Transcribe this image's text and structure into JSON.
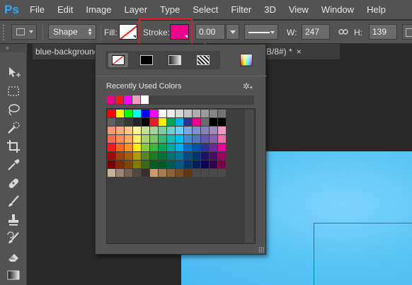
{
  "menubar": {
    "logo": "Ps",
    "items": [
      "File",
      "Edit",
      "Image",
      "Layer",
      "Type",
      "Select",
      "Filter",
      "3D",
      "View",
      "Window",
      "Help"
    ]
  },
  "options": {
    "mode": "Shape",
    "fill_label": "Fill:",
    "stroke_label": "Stroke:",
    "stroke_color": "#ec008c",
    "stroke_width": "0.00 pt",
    "w_label": "W:",
    "w_value": "247 px",
    "h_label": "H:",
    "h_value": "139 px"
  },
  "tabs": {
    "doc1": "blue-background",
    "doc2": "B/8#) *",
    "close": "×"
  },
  "swatch_panel": {
    "recent_label": "Recently Used Colors",
    "recent_colors": [
      "#ec008c",
      "#ed1c24",
      "#ff00ff",
      "#f49ac1",
      "#ffffff"
    ],
    "grid": [
      [
        "#ff0000",
        "#ffff00",
        "#00ff00",
        "#00ffff",
        "#0000ff",
        "#ff00ff",
        "#ffffff",
        "#ebebeb",
        "#d7d7d7",
        "#c3c3c3",
        "#afafaf",
        "#9b9b9b",
        "#878787",
        "#737373"
      ],
      [
        "#5f5f5f",
        "#4b4b4b",
        "#373737",
        "#232323",
        "#000000",
        "#ed1c24",
        "#fff200",
        "#00a651",
        "#00aeef",
        "#2e3192",
        "#ec008c",
        "#6b6b6b",
        "#000000",
        "#000000"
      ],
      [
        "#f7977a",
        "#f9ad81",
        "#fdc68a",
        "#fff79a",
        "#c4df9b",
        "#a3d39c",
        "#82ca9d",
        "#7accc8",
        "#6dcff6",
        "#7da7d9",
        "#8393ca",
        "#8781bd",
        "#a187be",
        "#f49ac1"
      ],
      [
        "#f26c4f",
        "#f68e55",
        "#fbaf5c",
        "#fff467",
        "#acd372",
        "#7cc576",
        "#3bb878",
        "#1abbb4",
        "#00bff3",
        "#438ccb",
        "#5574b9",
        "#605ca8",
        "#855fa8",
        "#f06ea9"
      ],
      [
        "#ed1c24",
        "#f26522",
        "#f7941d",
        "#fff200",
        "#8dc73f",
        "#39b54a",
        "#00a651",
        "#00a99d",
        "#00aeef",
        "#0072bc",
        "#0054a5",
        "#2e3192",
        "#662d91",
        "#ec008c"
      ],
      [
        "#9e0b0f",
        "#a0410d",
        "#a36209",
        "#aba000",
        "#598527",
        "#1a7b30",
        "#007236",
        "#00746b",
        "#0076a3",
        "#004b80",
        "#003471",
        "#1b1464",
        "#440e62",
        "#9e005d"
      ],
      [
        "#790000",
        "#7b2e00",
        "#7d4900",
        "#827b00",
        "#406618",
        "#005e20",
        "#005826",
        "#005952",
        "#005b7f",
        "#003663",
        "#002157",
        "#0d004c",
        "#32004b",
        "#7b0046"
      ],
      [
        "#c7b299",
        "#998675",
        "#736357",
        "#534741",
        "#37302d",
        "#c69c6d",
        "#a67c52",
        "#8c6239",
        "#754c24",
        "#603913",
        "#4a4a4a",
        "#4a4a4a",
        "#4a4a4a",
        "#4a4a4a"
      ]
    ]
  }
}
